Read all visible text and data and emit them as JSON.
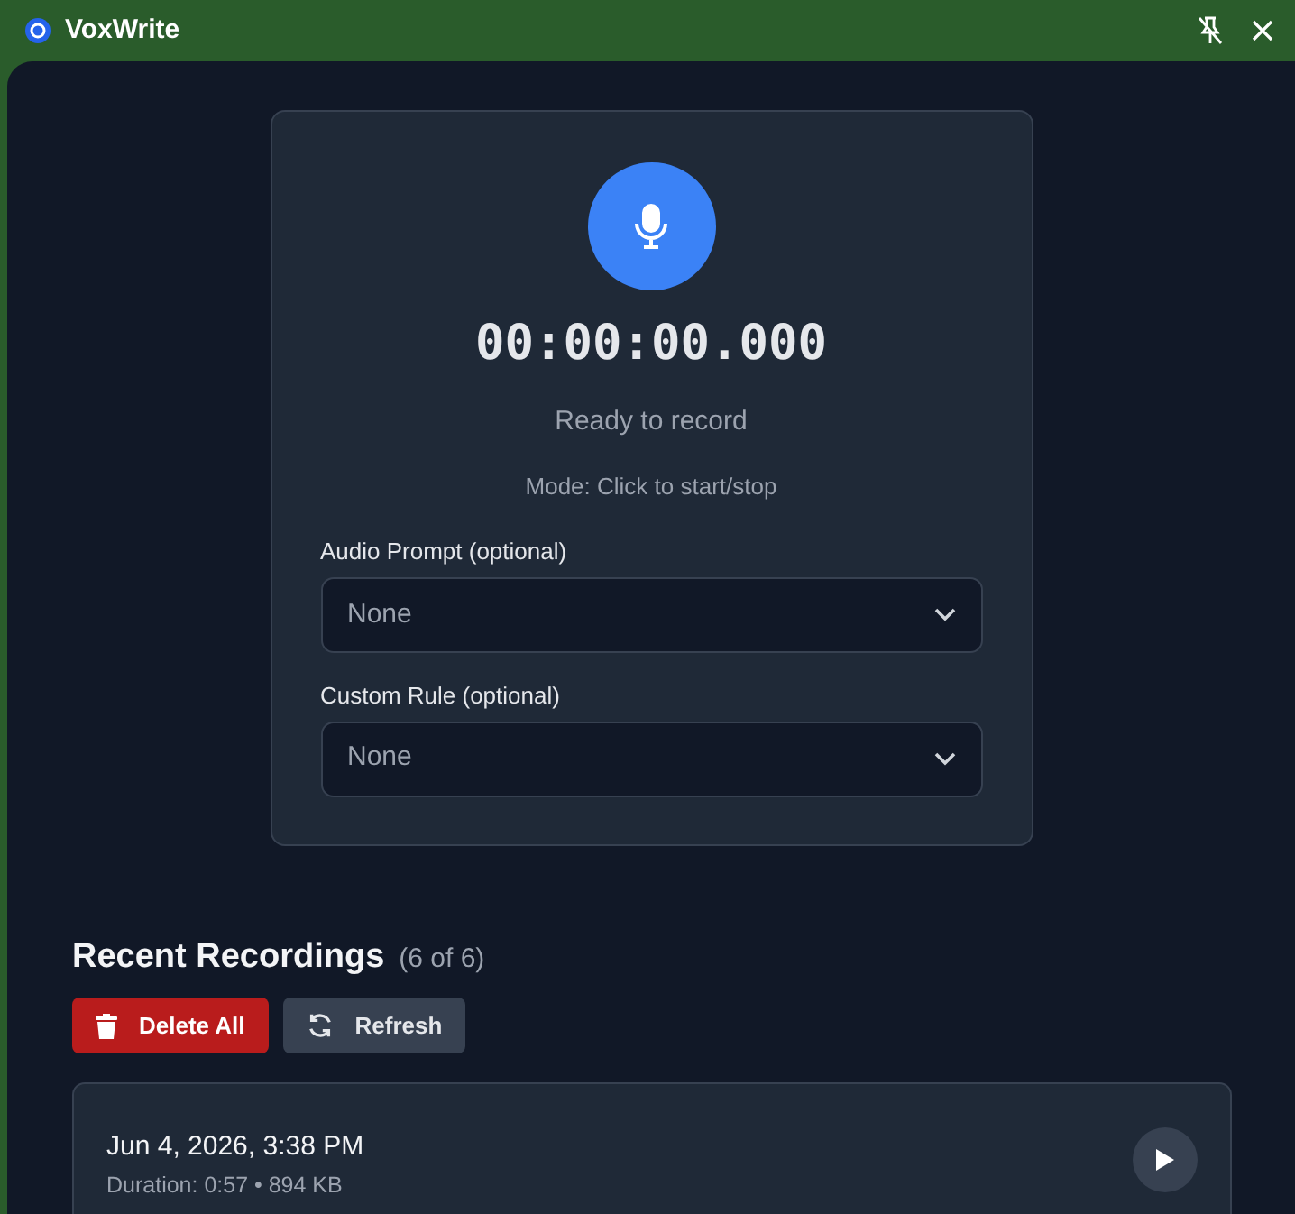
{
  "window": {
    "title": "VoxWrite"
  },
  "recorder": {
    "timer": "00:00:00.000",
    "status": "Ready to record",
    "mode": "Mode: Click to start/stop"
  },
  "fields": [
    {
      "label": "Audio Prompt (optional)",
      "value": "None"
    },
    {
      "label": "Custom Rule (optional)",
      "value": "None"
    }
  ],
  "recordings": {
    "title": "Recent Recordings",
    "count": "(6 of 6)",
    "buttons": [
      {
        "kind": "delete",
        "label": "Delete All"
      },
      {
        "kind": "refresh",
        "label": "Refresh"
      }
    ],
    "items": [
      {
        "date": "Jun 4, 2026, 3:38 PM",
        "details": "Duration: 0:57 • 894 KB"
      }
    ]
  }
}
